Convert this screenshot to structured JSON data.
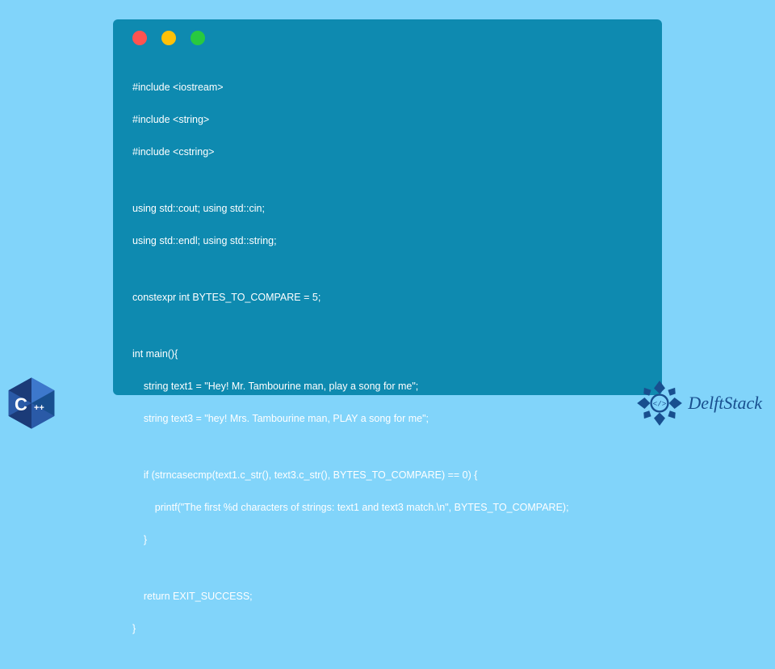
{
  "window": {
    "dot_colors": {
      "red": "#ff5350",
      "yellow": "#ffc107",
      "green": "#28c940"
    }
  },
  "code": {
    "l1": "#include <iostream>",
    "l2": "#include <string>",
    "l3": "#include <cstring>",
    "l4": "using std::cout; using std::cin;",
    "l5": "using std::endl; using std::string;",
    "l6": "constexpr int BYTES_TO_COMPARE = 5;",
    "l7": "int main(){",
    "l8": "    string text1 = \"Hey! Mr. Tambourine man, play a song for me\";",
    "l9": "    string text3 = \"hey! Mrs. Tambourine man, PLAY a song for me\";",
    "l10": "    if (strncasecmp(text1.c_str(), text3.c_str(), BYTES_TO_COMPARE) == 0) {",
    "l11": "        printf(\"The first %d characters of strings: text1 and text3 match.\\n\", BYTES_TO_COMPARE);",
    "l12": "    }",
    "l13": "    return EXIT_SUCCESS;",
    "l14": "}"
  },
  "logos": {
    "cpp_c": "C",
    "cpp_pp": "++",
    "delft": "DelftStack"
  },
  "colors": {
    "page_bg": "#81d4fa",
    "window_bg": "#0e8ab0",
    "code_text": "#ffffff",
    "cpp_hex_dark": "#1b3b78",
    "cpp_hex_mid": "#2a5aa7",
    "cpp_hex_light": "#3d78cc",
    "delft_blue": "#184f8f"
  }
}
